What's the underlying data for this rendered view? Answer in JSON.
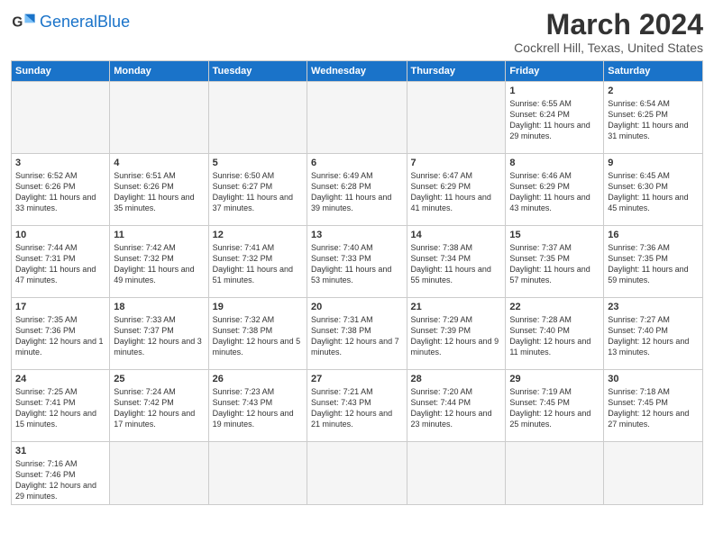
{
  "header": {
    "logo_general": "General",
    "logo_blue": "Blue",
    "month_year": "March 2024",
    "location": "Cockrell Hill, Texas, United States"
  },
  "days_of_week": [
    "Sunday",
    "Monday",
    "Tuesday",
    "Wednesday",
    "Thursday",
    "Friday",
    "Saturday"
  ],
  "weeks": [
    [
      {
        "day": "",
        "info": "",
        "empty": true
      },
      {
        "day": "",
        "info": "",
        "empty": true
      },
      {
        "day": "",
        "info": "",
        "empty": true
      },
      {
        "day": "",
        "info": "",
        "empty": true
      },
      {
        "day": "",
        "info": "",
        "empty": true
      },
      {
        "day": "1",
        "info": "Sunrise: 6:55 AM\nSunset: 6:24 PM\nDaylight: 11 hours and 29 minutes."
      },
      {
        "day": "2",
        "info": "Sunrise: 6:54 AM\nSunset: 6:25 PM\nDaylight: 11 hours and 31 minutes."
      }
    ],
    [
      {
        "day": "3",
        "info": "Sunrise: 6:52 AM\nSunset: 6:26 PM\nDaylight: 11 hours and 33 minutes."
      },
      {
        "day": "4",
        "info": "Sunrise: 6:51 AM\nSunset: 6:26 PM\nDaylight: 11 hours and 35 minutes."
      },
      {
        "day": "5",
        "info": "Sunrise: 6:50 AM\nSunset: 6:27 PM\nDaylight: 11 hours and 37 minutes."
      },
      {
        "day": "6",
        "info": "Sunrise: 6:49 AM\nSunset: 6:28 PM\nDaylight: 11 hours and 39 minutes."
      },
      {
        "day": "7",
        "info": "Sunrise: 6:47 AM\nSunset: 6:29 PM\nDaylight: 11 hours and 41 minutes."
      },
      {
        "day": "8",
        "info": "Sunrise: 6:46 AM\nSunset: 6:29 PM\nDaylight: 11 hours and 43 minutes."
      },
      {
        "day": "9",
        "info": "Sunrise: 6:45 AM\nSunset: 6:30 PM\nDaylight: 11 hours and 45 minutes."
      }
    ],
    [
      {
        "day": "10",
        "info": "Sunrise: 7:44 AM\nSunset: 7:31 PM\nDaylight: 11 hours and 47 minutes."
      },
      {
        "day": "11",
        "info": "Sunrise: 7:42 AM\nSunset: 7:32 PM\nDaylight: 11 hours and 49 minutes."
      },
      {
        "day": "12",
        "info": "Sunrise: 7:41 AM\nSunset: 7:32 PM\nDaylight: 11 hours and 51 minutes."
      },
      {
        "day": "13",
        "info": "Sunrise: 7:40 AM\nSunset: 7:33 PM\nDaylight: 11 hours and 53 minutes."
      },
      {
        "day": "14",
        "info": "Sunrise: 7:38 AM\nSunset: 7:34 PM\nDaylight: 11 hours and 55 minutes."
      },
      {
        "day": "15",
        "info": "Sunrise: 7:37 AM\nSunset: 7:35 PM\nDaylight: 11 hours and 57 minutes."
      },
      {
        "day": "16",
        "info": "Sunrise: 7:36 AM\nSunset: 7:35 PM\nDaylight: 11 hours and 59 minutes."
      }
    ],
    [
      {
        "day": "17",
        "info": "Sunrise: 7:35 AM\nSunset: 7:36 PM\nDaylight: 12 hours and 1 minute."
      },
      {
        "day": "18",
        "info": "Sunrise: 7:33 AM\nSunset: 7:37 PM\nDaylight: 12 hours and 3 minutes."
      },
      {
        "day": "19",
        "info": "Sunrise: 7:32 AM\nSunset: 7:38 PM\nDaylight: 12 hours and 5 minutes."
      },
      {
        "day": "20",
        "info": "Sunrise: 7:31 AM\nSunset: 7:38 PM\nDaylight: 12 hours and 7 minutes."
      },
      {
        "day": "21",
        "info": "Sunrise: 7:29 AM\nSunset: 7:39 PM\nDaylight: 12 hours and 9 minutes."
      },
      {
        "day": "22",
        "info": "Sunrise: 7:28 AM\nSunset: 7:40 PM\nDaylight: 12 hours and 11 minutes."
      },
      {
        "day": "23",
        "info": "Sunrise: 7:27 AM\nSunset: 7:40 PM\nDaylight: 12 hours and 13 minutes."
      }
    ],
    [
      {
        "day": "24",
        "info": "Sunrise: 7:25 AM\nSunset: 7:41 PM\nDaylight: 12 hours and 15 minutes."
      },
      {
        "day": "25",
        "info": "Sunrise: 7:24 AM\nSunset: 7:42 PM\nDaylight: 12 hours and 17 minutes."
      },
      {
        "day": "26",
        "info": "Sunrise: 7:23 AM\nSunset: 7:43 PM\nDaylight: 12 hours and 19 minutes."
      },
      {
        "day": "27",
        "info": "Sunrise: 7:21 AM\nSunset: 7:43 PM\nDaylight: 12 hours and 21 minutes."
      },
      {
        "day": "28",
        "info": "Sunrise: 7:20 AM\nSunset: 7:44 PM\nDaylight: 12 hours and 23 minutes."
      },
      {
        "day": "29",
        "info": "Sunrise: 7:19 AM\nSunset: 7:45 PM\nDaylight: 12 hours and 25 minutes."
      },
      {
        "day": "30",
        "info": "Sunrise: 7:18 AM\nSunset: 7:45 PM\nDaylight: 12 hours and 27 minutes."
      }
    ],
    [
      {
        "day": "31",
        "info": "Sunrise: 7:16 AM\nSunset: 7:46 PM\nDaylight: 12 hours and 29 minutes.",
        "last": true
      },
      {
        "day": "",
        "info": "",
        "empty": true,
        "last": true
      },
      {
        "day": "",
        "info": "",
        "empty": true,
        "last": true
      },
      {
        "day": "",
        "info": "",
        "empty": true,
        "last": true
      },
      {
        "day": "",
        "info": "",
        "empty": true,
        "last": true
      },
      {
        "day": "",
        "info": "",
        "empty": true,
        "last": true
      },
      {
        "day": "",
        "info": "",
        "empty": true,
        "last": true
      }
    ]
  ]
}
